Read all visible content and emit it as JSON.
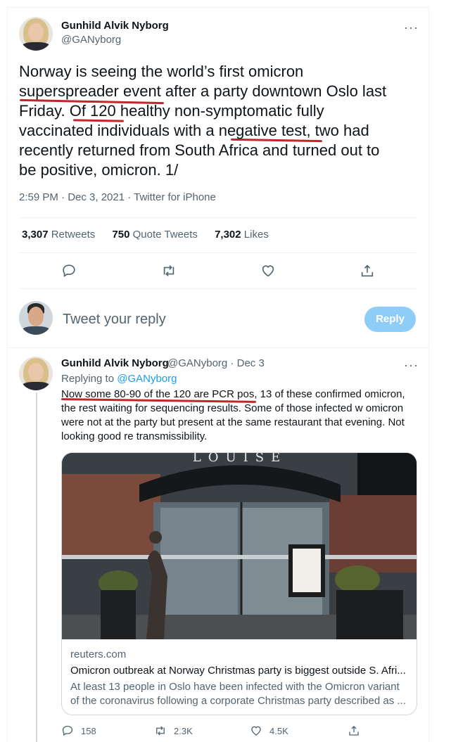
{
  "main_tweet": {
    "author_name": "Gunhild Alvik Nyborg",
    "author_handle": "@GANyborg",
    "text": "Norway is seeing the world’s first omicron\nsuperspreader event after a party downtown Oslo last\nFriday. Of 120 healthy non-symptomatic fully\nvaccinated individuals with a negative test, two had\nrecently returned from South Africa and turned out to\nbe positive, omicron. 1/",
    "timestamp": "2:59 PM · Dec 3, 2021 · Twitter for iPhone",
    "stats": {
      "retweets_count": "3,307",
      "retweets_label": "Retweets",
      "quotes_count": "750",
      "quotes_label": "Quote Tweets",
      "likes_count": "7,302",
      "likes_label": "Likes"
    },
    "actions": [
      "reply-icon",
      "retweet-icon",
      "like-icon",
      "share-icon"
    ],
    "more_label": "···"
  },
  "composer": {
    "placeholder": "Tweet your reply",
    "button_label": "Reply"
  },
  "reply_tweet": {
    "author_name": "Gunhild Alvik Nyborg",
    "author_handle": "@GANyborg",
    "separator": " · ",
    "date": "Dec 3",
    "replying_prefix": "Replying to ",
    "replying_handle": "@GANyborg",
    "text": "Now some 80-90 of the 120 are PCR pos, 13 of these confirmed omicron, the rest waiting for sequencing results. Some of those infected w omicron were not at the party but present at the same restaurant that evening. Not looking good re transmissibility.",
    "more_label": "···",
    "card": {
      "sign_text": "LOUISE",
      "domain": "reuters.com",
      "title": "Omicron outbreak at Norway Christmas party is biggest outside S. Afri...",
      "description": "At least 13 people in Oslo have been infected with the Omicron variant of the coronavirus following a corporate Christmas party described as ..."
    },
    "counts": {
      "replies": "158",
      "retweets": "2.3K",
      "likes": "4.5K"
    }
  },
  "colors": {
    "accent": "#1d9bf0",
    "reply_button": "#8ecdf8",
    "annotation_ink": "#c0262b",
    "muted_text": "#536471"
  }
}
